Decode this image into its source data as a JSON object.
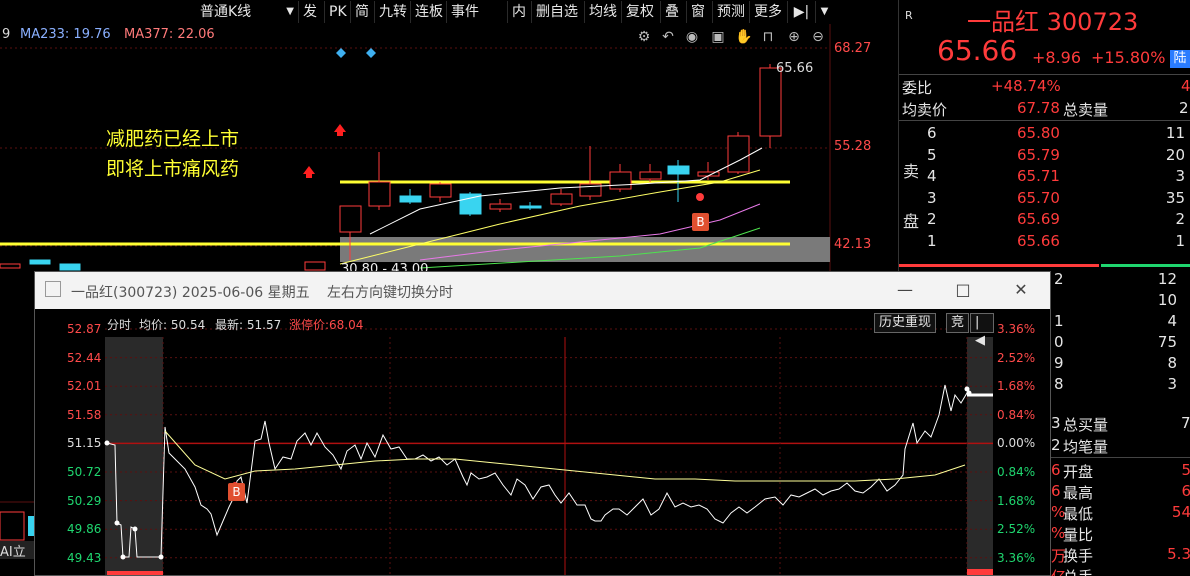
{
  "toolbar": {
    "chart_type": "普通K线",
    "items": [
      "发",
      "PK",
      "简",
      "九转",
      "连板",
      "事件",
      "内",
      "删自选",
      "均线",
      "复权",
      "叠",
      "窗",
      "预测",
      "更多"
    ]
  },
  "legend": {
    "ma233": "MA233: 19.76",
    "ma377": "MA377: 22.06",
    "left_cut": "9"
  },
  "annotation": {
    "line1": "减肥药已经上市",
    "line2": "即将上市痛风药"
  },
  "price_axis": [
    "68.27",
    "55.28",
    "42.13"
  ],
  "last_price_tag": "65.66",
  "range_label": "30.80 - 43.00",
  "marker_b": "B",
  "bottom_left_text": "AI立",
  "quote": {
    "r_icon": "R",
    "name": "一品红",
    "code": "300723",
    "price": "65.66",
    "change": "+8.96",
    "pct": "+15.80%",
    "badge": "陆",
    "weibi_label": "委比",
    "weibi": "+48.74%",
    "weibi_right": "4",
    "avgsell_label": "均卖价",
    "avgsell": "67.78",
    "totalsell_label": "总卖量",
    "totalsell": "2",
    "sell_side_label": "卖",
    "sell_side_label2": "盘",
    "asks": [
      {
        "lvl": "6",
        "price": "65.80",
        "vol": "11"
      },
      {
        "lvl": "5",
        "price": "65.79",
        "vol": "20"
      },
      {
        "lvl": "4",
        "price": "65.71",
        "vol": "3"
      },
      {
        "lvl": "3",
        "price": "65.70",
        "vol": "35"
      },
      {
        "lvl": "2",
        "price": "65.69",
        "vol": "2"
      },
      {
        "lvl": "1",
        "price": "65.66",
        "vol": "1"
      }
    ],
    "bids_partial": [
      {
        "lvl": "2",
        "vol": "12"
      },
      {
        "lvl": "",
        "vol": "10"
      },
      {
        "lvl": "1",
        "vol": "4"
      },
      {
        "lvl": "0",
        "vol": "75"
      },
      {
        "lvl": "9",
        "vol": "8"
      },
      {
        "lvl": "8",
        "vol": "3"
      }
    ],
    "totalbuy_label": "总买量",
    "totalbuy_prefix": "3",
    "totalbuy": "7",
    "avgbuy_prefix": "2",
    "avgbuy_label": "均笔量",
    "stats": [
      {
        "p": "6",
        "label": "开盘",
        "val": "5"
      },
      {
        "p": "6",
        "label": "最高",
        "val": "6"
      },
      {
        "p": "%",
        "label": "最低",
        "val": "54"
      },
      {
        "p": "%",
        "label": "量比",
        "val": ""
      },
      {
        "p": "万",
        "label": "换手",
        "val": "5.3"
      },
      {
        "p": "亿",
        "label": "总手",
        "val": ""
      }
    ]
  },
  "popup": {
    "title": "一品红(300723) 2025-06-06 星期五",
    "hint": "左右方向键切换分时",
    "min_btn": "—",
    "max_btn": "□",
    "close_btn": "✕",
    "hdr_fenshi": "分时",
    "hdr_avg": "均价: 50.54",
    "hdr_latest": "最新: 51.57",
    "hdr_limit": "涨停价:68.04",
    "btn_history": "历史重现",
    "btn_jing": "竞",
    "yleft": [
      "52.87",
      "52.44",
      "52.01",
      "51.58",
      "51.15",
      "50.72",
      "50.29",
      "49.86",
      "49.43"
    ],
    "yright": [
      "3.36%",
      "2.52%",
      "1.68%",
      "0.84%",
      "0.00%",
      "0.84%",
      "1.68%",
      "2.52%",
      "3.36%"
    ],
    "marker_b": "B"
  }
}
